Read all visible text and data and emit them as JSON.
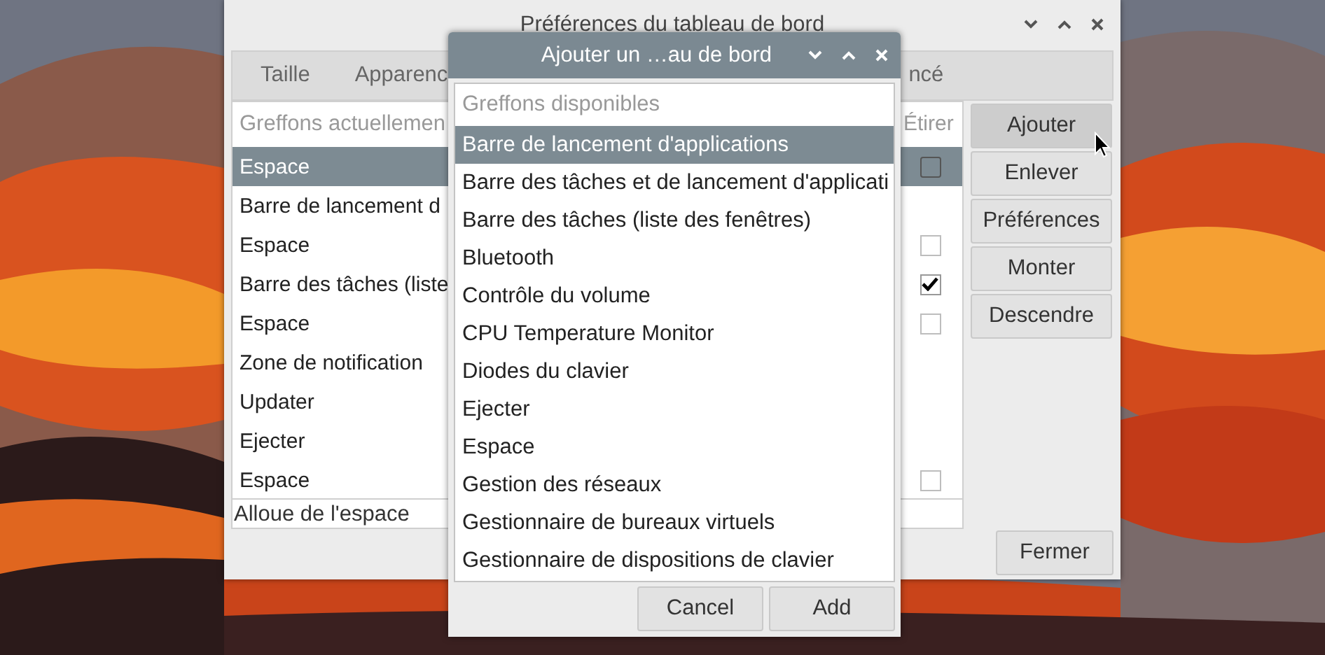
{
  "preferences_window": {
    "title": "Préférences du tableau de bord",
    "tabs": [
      {
        "label": "Taille",
        "selected": false
      },
      {
        "label": "Apparenc",
        "selected": false
      },
      {
        "label": "ncé",
        "selected": false
      }
    ],
    "plugins_list": {
      "header": "Greffons actuellemen",
      "stretch_header": "Étirer",
      "rows": [
        {
          "label": "Espace",
          "selected": true,
          "checked": false
        },
        {
          "label": "Barre de lancement d",
          "selected": false
        },
        {
          "label": "Espace",
          "selected": false,
          "checked": false
        },
        {
          "label": "Barre des tâches (liste",
          "selected": false,
          "checked": true
        },
        {
          "label": "Espace",
          "selected": false,
          "checked": false
        },
        {
          "label": "Zone de notification",
          "selected": false
        },
        {
          "label": "Updater",
          "selected": false
        },
        {
          "label": "Ejecter",
          "selected": false
        },
        {
          "label": "Espace",
          "selected": false,
          "checked": false
        }
      ]
    },
    "status": "Alloue de l'espace",
    "buttons": [
      {
        "label": "Ajouter",
        "hovered": true
      },
      {
        "label": "Enlever",
        "hovered": false
      },
      {
        "label": "Préférences",
        "hovered": false
      },
      {
        "label": "Monter",
        "hovered": false
      },
      {
        "label": "Descendre",
        "hovered": false
      }
    ],
    "close_button": "Fermer"
  },
  "add_dialog": {
    "title": "Ajouter un …au de bord",
    "list_header": "Greffons disponibles",
    "items": [
      {
        "label": "Barre de lancement d'applications",
        "selected": true
      },
      {
        "label": "Barre des tâches et de lancement d'applicati",
        "selected": false
      },
      {
        "label": "Barre des tâches (liste des fenêtres)",
        "selected": false
      },
      {
        "label": "Bluetooth",
        "selected": false
      },
      {
        "label": "Contrôle du volume",
        "selected": false
      },
      {
        "label": "CPU Temperature Monitor",
        "selected": false
      },
      {
        "label": "Diodes du clavier",
        "selected": false
      },
      {
        "label": "Ejecter",
        "selected": false
      },
      {
        "label": "Espace",
        "selected": false
      },
      {
        "label": "Gestion des réseaux",
        "selected": false
      },
      {
        "label": "Gestionnaire de bureaux virtuels",
        "selected": false
      },
      {
        "label": "Gestionnaire de dispositions de clavier",
        "selected": false
      }
    ],
    "buttons": [
      "Cancel",
      "Add"
    ]
  }
}
